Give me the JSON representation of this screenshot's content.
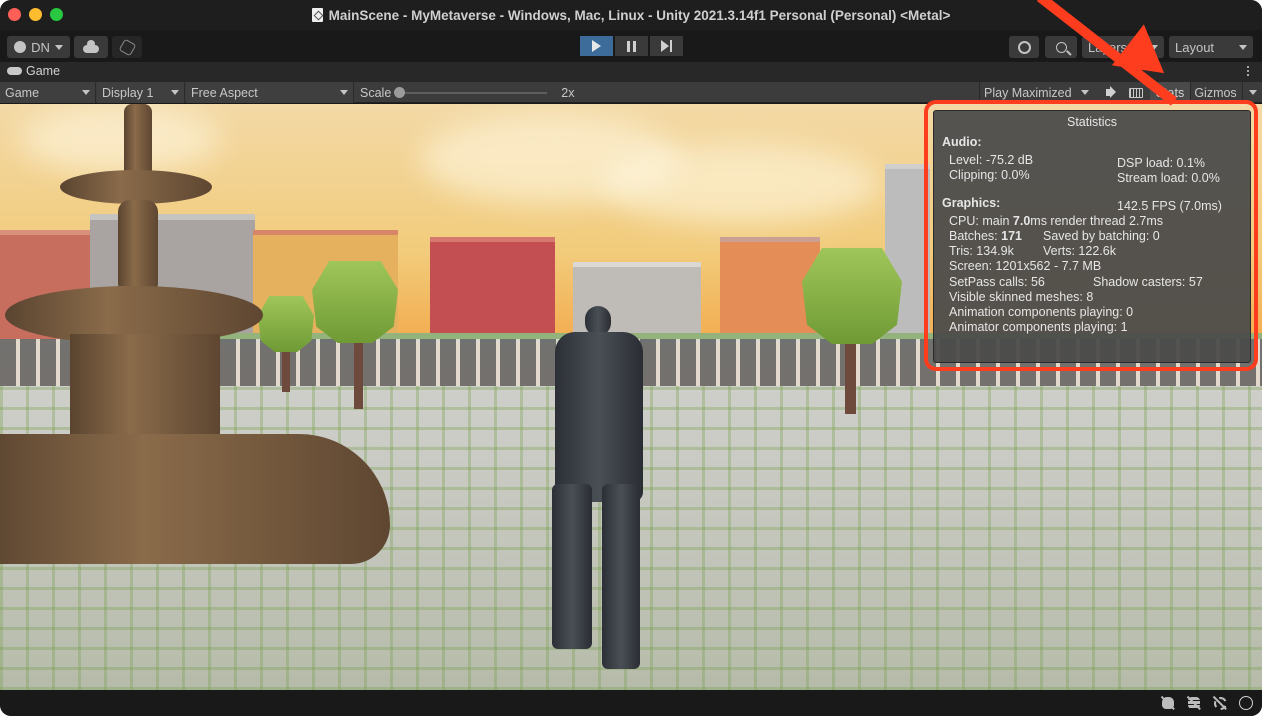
{
  "window": {
    "title": "MainScene - MyMetaverse - Windows, Mac, Linux - Unity 2021.3.14f1 Personal (Personal) <Metal>"
  },
  "toolbar": {
    "account_label": "DN",
    "layers_label": "Layers",
    "layout_label": "Layout",
    "play_state": "playing"
  },
  "game_tab": {
    "label": "Game"
  },
  "game_controls": {
    "view_mode": "Game",
    "display": "Display 1",
    "aspect": "Free Aspect",
    "scale_label": "Scale",
    "scale_value": "2x",
    "scale_fraction": 0.0,
    "play_mode": "Play Maximized",
    "stats_label": "Stats",
    "stats_active": true,
    "gizmos_label": "Gizmos"
  },
  "statistics": {
    "title": "Statistics",
    "audio": {
      "heading": "Audio:",
      "level": "Level: -75.2 dB",
      "clipping": "Clipping: 0.0%",
      "dsp_load": "DSP load: 0.1%",
      "stream_load": "Stream load: 0.0%"
    },
    "graphics": {
      "heading": "Graphics:",
      "fps": "142.5 FPS (7.0ms)",
      "cpu_prefix": "CPU: main ",
      "cpu_main": "7.0",
      "cpu_suffix": "ms  render thread 2.7ms",
      "batches_prefix": "Batches: ",
      "batches": "171",
      "saved_by_batching": "Saved by batching: 0",
      "tris": "Tris: 134.9k",
      "verts": "Verts: 122.6k",
      "screen": "Screen: 1201x562 - 7.7 MB",
      "setpass": "SetPass calls: 56",
      "shadow_casters": "Shadow casters: 57",
      "skinned_meshes": "Visible skinned meshes: 8",
      "animation_components": "Animation components playing: 0",
      "animator_components": "Animator components playing: 1"
    }
  },
  "annotation": {
    "color": "#fe3d1f",
    "target": "Stats"
  },
  "colors": {
    "play_active": "#3e6c9a",
    "editor_bg": "#191919"
  }
}
